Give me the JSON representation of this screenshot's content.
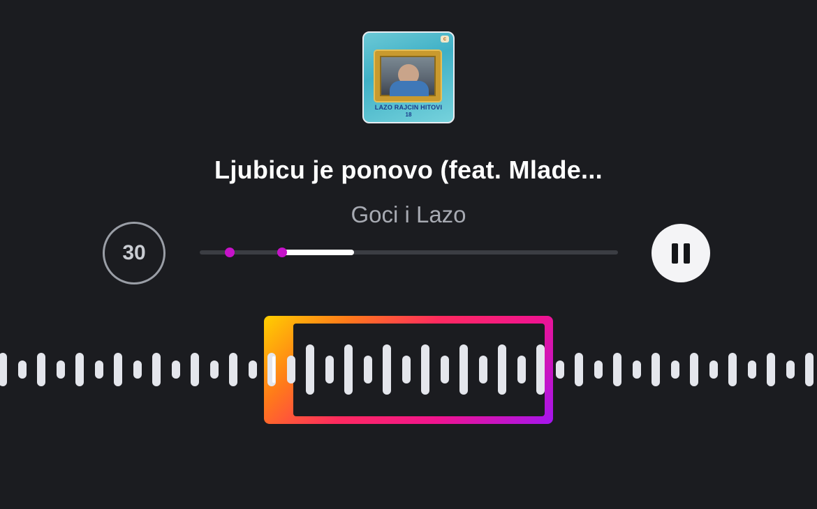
{
  "album": {
    "cover_title": "LAZO RAJCIN HITOVI",
    "cover_number": "18",
    "logo_icon": "label-logo-icon"
  },
  "track": {
    "title": "Ljubicu je ponovo (feat. Mlade...",
    "artist": "Goci i Lazo"
  },
  "controls": {
    "duration_label": "30",
    "pause_icon": "pause-icon"
  },
  "scrubber": {
    "selection_start_fraction": 0.07,
    "selection_end_fraction": 0.195,
    "progress_start_fraction": 0.195,
    "progress_end_fraction": 0.37
  },
  "colors": {
    "background": "#1b1c20",
    "accent_magenta": "#c613c9",
    "gradient_start": "#ffcf00",
    "gradient_mid": "#ff2a5f",
    "gradient_end": "#a315f0"
  }
}
